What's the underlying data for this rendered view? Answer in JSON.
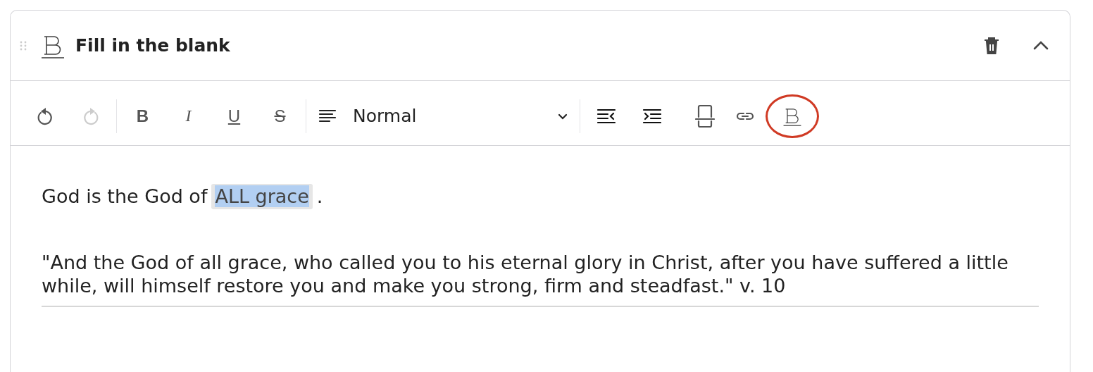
{
  "block": {
    "title": "Fill in the blank",
    "expanded": true
  },
  "toolbar": [
    {
      "kind": "undo",
      "disabled": false
    },
    {
      "kind": "redo",
      "disabled": true
    },
    {
      "kind": "separator"
    },
    {
      "kind": "bold",
      "label": "B"
    },
    {
      "kind": "italic",
      "label": "I"
    },
    {
      "kind": "underline",
      "label": "U"
    },
    {
      "kind": "strike",
      "label": "S"
    },
    {
      "kind": "separator"
    },
    {
      "kind": "format",
      "value": "Normal"
    },
    {
      "kind": "separator"
    },
    {
      "kind": "outdent"
    },
    {
      "kind": "indent"
    },
    {
      "kind": "blank-line"
    },
    {
      "kind": "link"
    },
    {
      "kind": "blank",
      "circled": true
    }
  ],
  "content": [
    {
      "before": "God is the God of",
      "blank": "ALL grace",
      "selected": true,
      "after": "."
    },
    {
      "text": "\"And the God of all grace, who called you to his eternal glory in Christ, after you have suffered a little while, will himself restore you and make you strong, firm and steadfast.\" v. 10"
    }
  ]
}
